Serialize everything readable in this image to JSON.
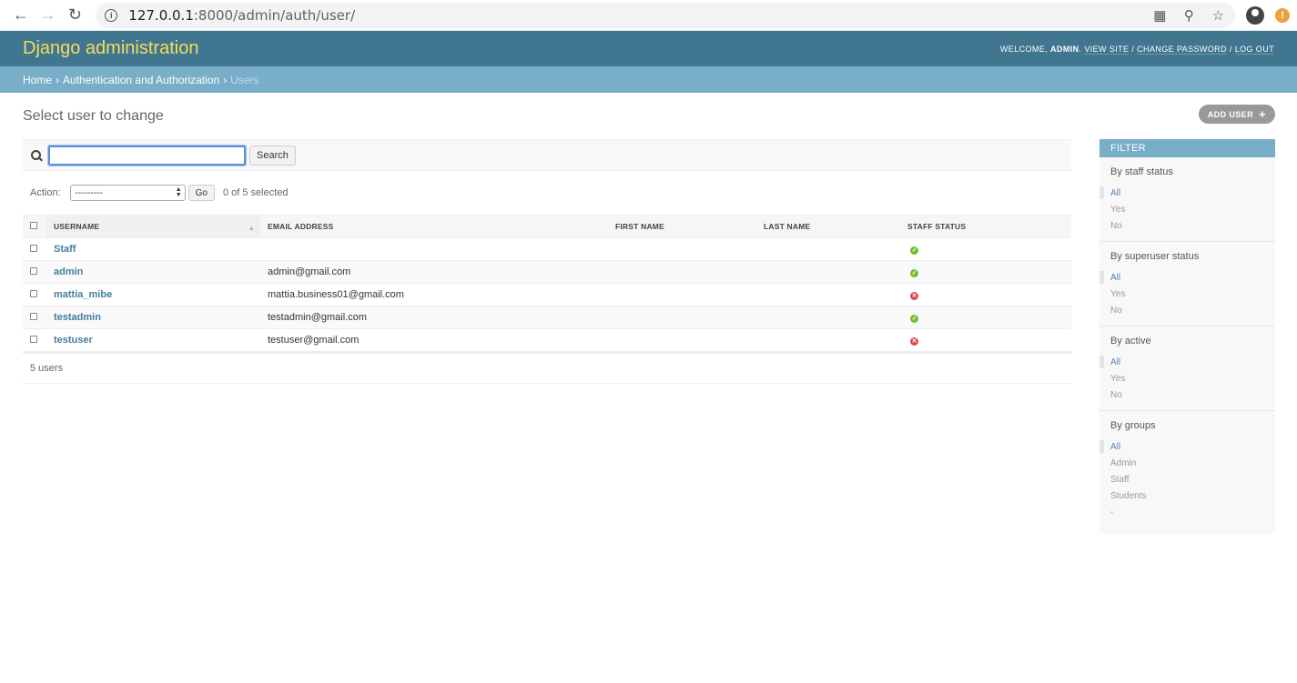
{
  "browser": {
    "url_host": "127.0.0.1",
    "url_path": ":8000/admin/auth/user/"
  },
  "header": {
    "branding": "Django administration",
    "welcome": "Welcome,",
    "user": "admin",
    "view_site": "View site",
    "change_password": "Change password",
    "log_out": "Log out"
  },
  "breadcrumbs": {
    "home": "Home",
    "app": "Authentication and Authorization",
    "current": "Users"
  },
  "page": {
    "title": "Select user to change",
    "add_button": "Add user"
  },
  "search": {
    "value": "",
    "button": "Search"
  },
  "actions": {
    "label": "Action:",
    "selected_option": "---------",
    "go": "Go",
    "count": "0 of 5 selected"
  },
  "table": {
    "columns": [
      "Username",
      "Email address",
      "First name",
      "Last name",
      "Staff status"
    ],
    "rows": [
      {
        "username": "Staff",
        "email": "",
        "first_name": "",
        "last_name": "",
        "staff": true
      },
      {
        "username": "admin",
        "email": "admin@gmail.com",
        "first_name": "",
        "last_name": "",
        "staff": true
      },
      {
        "username": "mattia_mibe",
        "email": "mattia.business01@gmail.com",
        "first_name": "",
        "last_name": "",
        "staff": false
      },
      {
        "username": "testadmin",
        "email": "testadmin@gmail.com",
        "first_name": "",
        "last_name": "",
        "staff": true
      },
      {
        "username": "testuser",
        "email": "testuser@gmail.com",
        "first_name": "",
        "last_name": "",
        "staff": false
      }
    ]
  },
  "paginator": "5 users",
  "filter": {
    "title": "Filter",
    "groups": [
      {
        "heading": "By staff status",
        "options": [
          "All",
          "Yes",
          "No"
        ],
        "selected": 0
      },
      {
        "heading": "By superuser status",
        "options": [
          "All",
          "Yes",
          "No"
        ],
        "selected": 0
      },
      {
        "heading": "By active",
        "options": [
          "All",
          "Yes",
          "No"
        ],
        "selected": 0
      },
      {
        "heading": "By groups",
        "options": [
          "All",
          "Admin",
          "Staff",
          "Students",
          "-"
        ],
        "selected": 0
      }
    ]
  },
  "colors": {
    "header_bg": "#417690",
    "branding": "#f5dd5d",
    "breadcrumb_bg": "#79aec8",
    "link": "#447e9b",
    "yes": "#70bf2b",
    "no": "#dd4646"
  }
}
